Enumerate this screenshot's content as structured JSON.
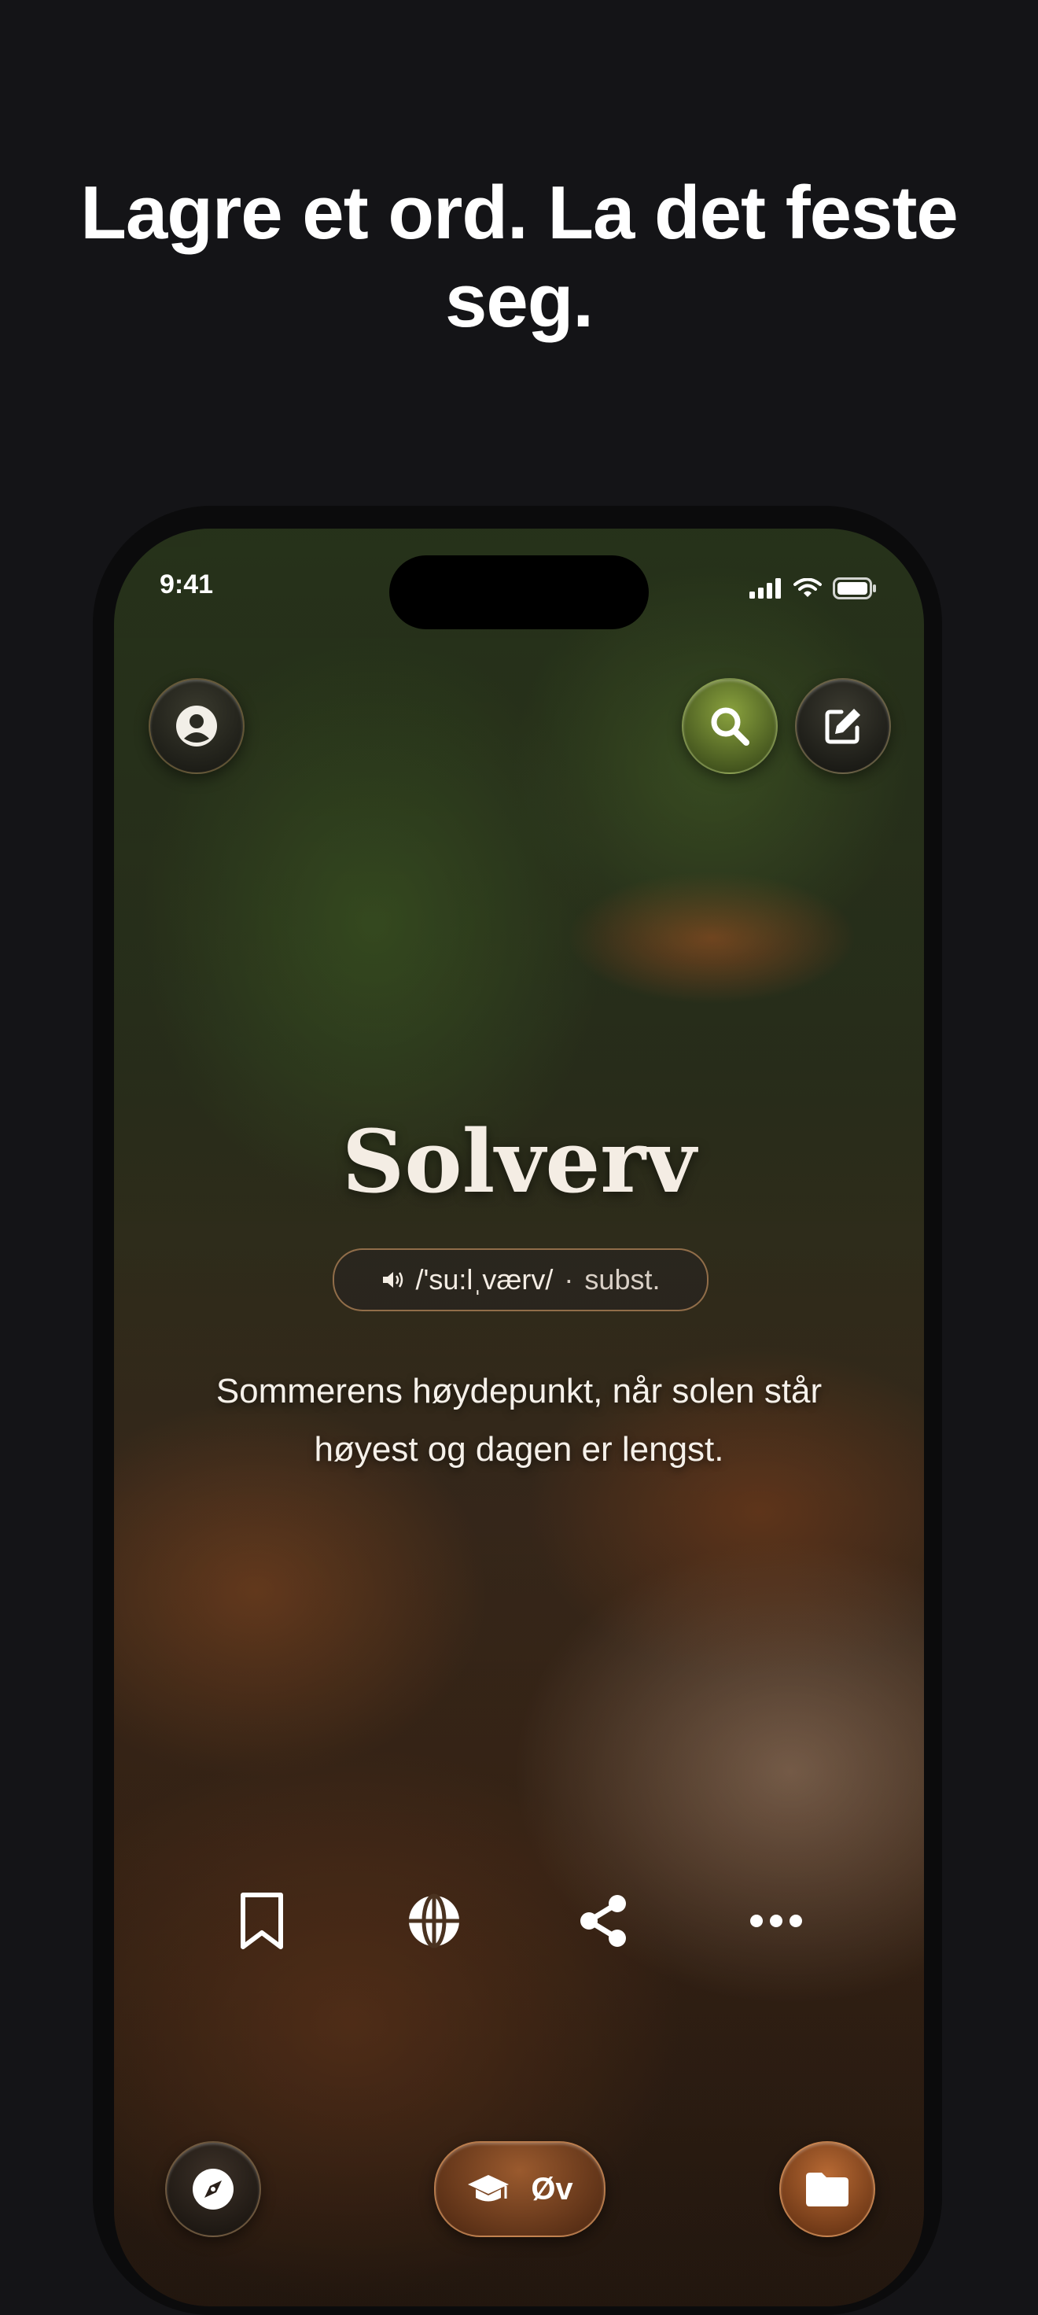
{
  "headline": "Lagre et ord. La det feste seg.",
  "status_bar": {
    "time": "9:41"
  },
  "top_buttons": {
    "profile_icon": "person-circle-icon",
    "search_icon": "search-icon",
    "edit_icon": "edit-icon"
  },
  "entry": {
    "word": "Solverv",
    "pronunciation": "/'su:lˌværv/",
    "separator": "·",
    "part_of_speech": "subst.",
    "definition": "Sommerens høydepunkt, når solen står høyest og dagen er lengst."
  },
  "actions": [
    "bookmark-icon",
    "globe-icon",
    "share-icon",
    "more-icon"
  ],
  "bottom_nav": {
    "practice_label": "Øv"
  },
  "colors": {
    "background": "#141417",
    "accent": "#9a5a2e",
    "text": "#ffffff"
  }
}
